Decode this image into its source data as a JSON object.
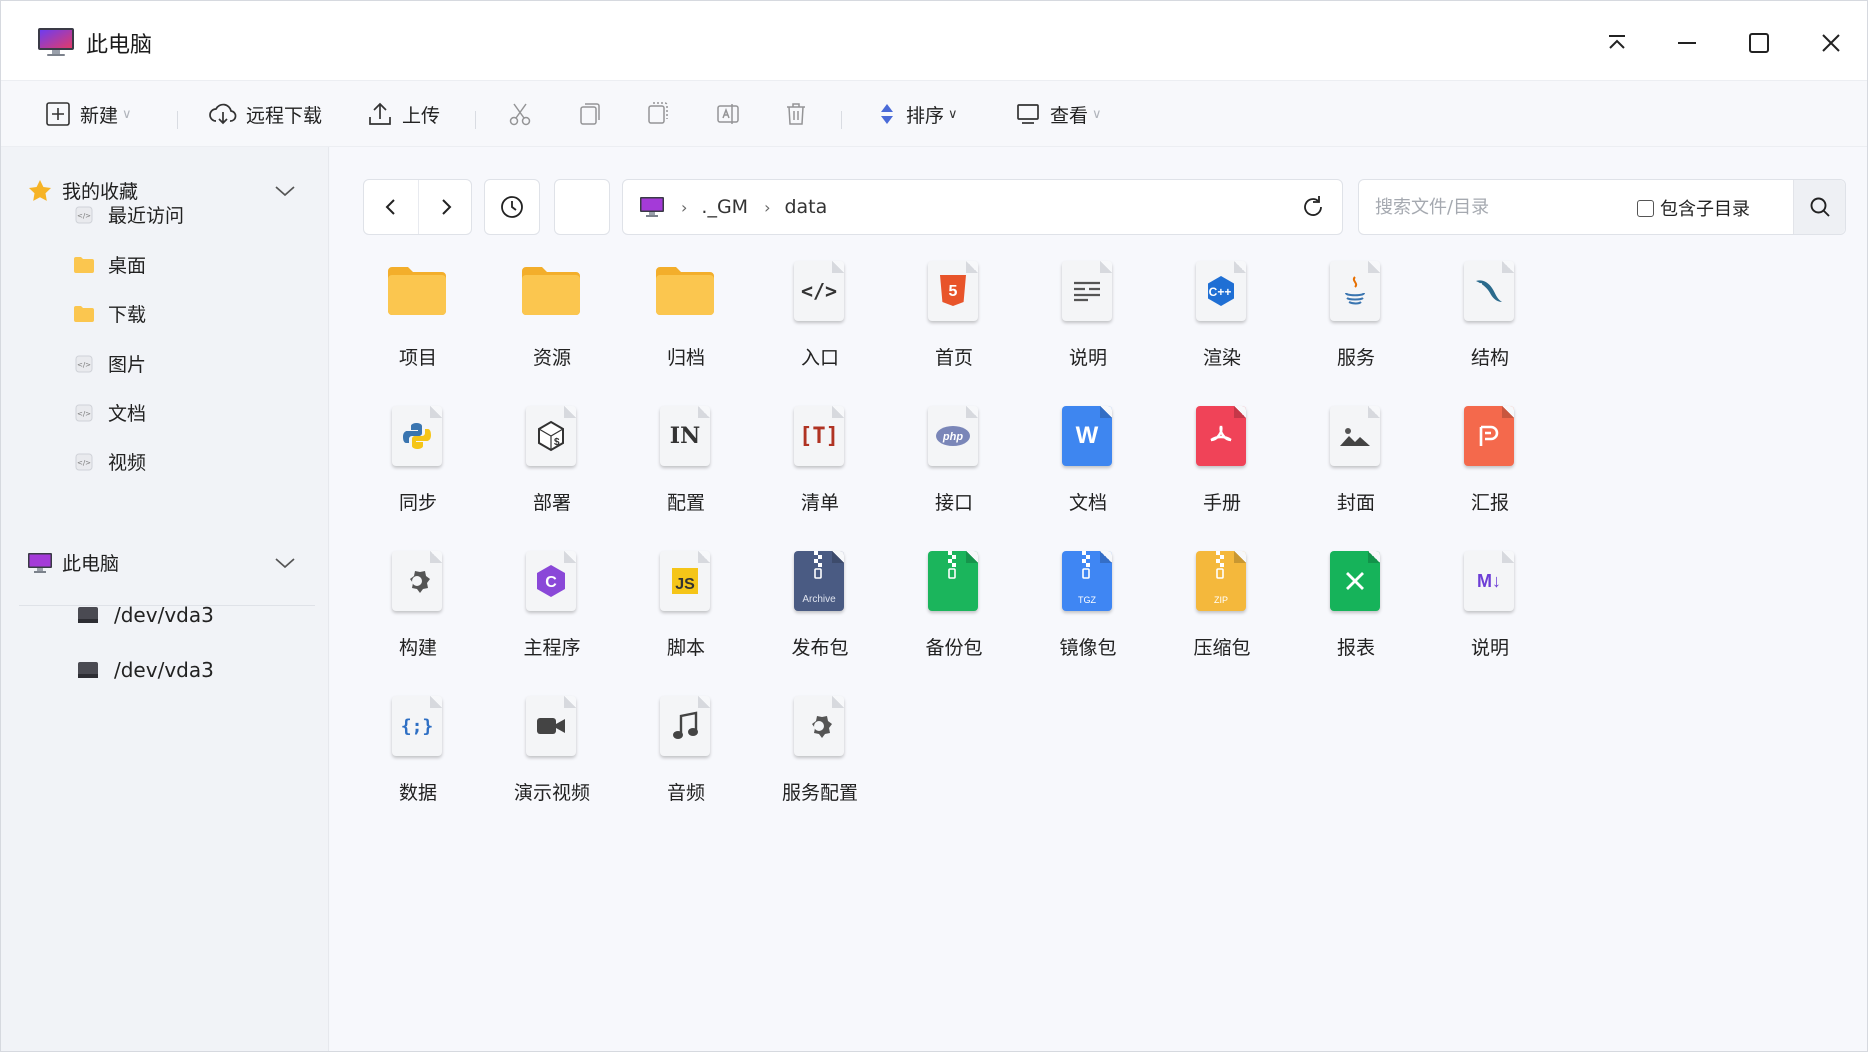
{
  "window": {
    "title": "此电脑"
  },
  "toolbar": {
    "new_label": "新建",
    "remote_download_label": "远程下载",
    "upload_label": "上传",
    "sort_label": "排序",
    "view_label": "查看"
  },
  "sidebar": {
    "favorites_label": "我的收藏",
    "favorites": [
      {
        "label": "最近访问",
        "icon": "code-file-icon"
      },
      {
        "label": "桌面",
        "icon": "folder-icon"
      },
      {
        "label": "下载",
        "icon": "folder-icon"
      },
      {
        "label": "图片",
        "icon": "code-file-icon"
      },
      {
        "label": "文档",
        "icon": "code-file-icon"
      },
      {
        "label": "视频",
        "icon": "code-file-icon"
      }
    ],
    "computer_label": "此电脑",
    "drives": [
      {
        "label": "/dev/vda3",
        "icon": "drive-icon"
      },
      {
        "label": "/dev/vda3",
        "icon": "drive-icon"
      }
    ]
  },
  "path": {
    "segments": [
      "._GM",
      "data"
    ]
  },
  "search": {
    "placeholder": "搜索文件/目录",
    "include_subdir_label": "包含子目录"
  },
  "files": [
    {
      "name": "项目",
      "type": "folder"
    },
    {
      "name": "资源",
      "type": "folder"
    },
    {
      "name": "归档",
      "type": "folder"
    },
    {
      "name": "入口",
      "type": "html"
    },
    {
      "name": "首页",
      "type": "html5"
    },
    {
      "name": "说明",
      "type": "text"
    },
    {
      "name": "渲染",
      "type": "cpp"
    },
    {
      "name": "服务",
      "type": "java"
    },
    {
      "name": "结构",
      "type": "mysql"
    },
    {
      "name": "同步",
      "type": "python"
    },
    {
      "name": "部署",
      "type": "shell"
    },
    {
      "name": "配置",
      "type": "ini"
    },
    {
      "name": "清单",
      "type": "txt"
    },
    {
      "name": "接口",
      "type": "php"
    },
    {
      "name": "文档",
      "type": "word"
    },
    {
      "name": "手册",
      "type": "pdf"
    },
    {
      "name": "封面",
      "type": "image"
    },
    {
      "name": "汇报",
      "type": "ppt"
    },
    {
      "name": "构建",
      "type": "config"
    },
    {
      "name": "主程序",
      "type": "csharp"
    },
    {
      "name": "脚本",
      "type": "js"
    },
    {
      "name": "发布包",
      "type": "archive",
      "badge": "Archive"
    },
    {
      "name": "备份包",
      "type": "zip-green"
    },
    {
      "name": "镜像包",
      "type": "tgz",
      "badge": "TGZ"
    },
    {
      "name": "压缩包",
      "type": "zip",
      "badge": "ZIP"
    },
    {
      "name": "报表",
      "type": "excel"
    },
    {
      "name": "说明",
      "type": "markdown",
      "badge": "M↓"
    },
    {
      "name": "数据",
      "type": "json",
      "badge": "{;}"
    },
    {
      "name": "演示视频",
      "type": "video"
    },
    {
      "name": "音频",
      "type": "audio"
    },
    {
      "name": "服务配置",
      "type": "config"
    }
  ],
  "colors": {
    "folder": "#fbc64f",
    "html5": "#e8542a",
    "cpp": "#1f6fd4",
    "word": "#3e86f0",
    "pdf": "#f04358",
    "ppt": "#f4694c",
    "archive": "#4a5b83",
    "zip_green": "#1bb55c",
    "tgz": "#3f86f3",
    "zip": "#f4b83c",
    "excel": "#16b35a",
    "markdown": "#6d3ed6",
    "csharp": "#8a48d8"
  }
}
